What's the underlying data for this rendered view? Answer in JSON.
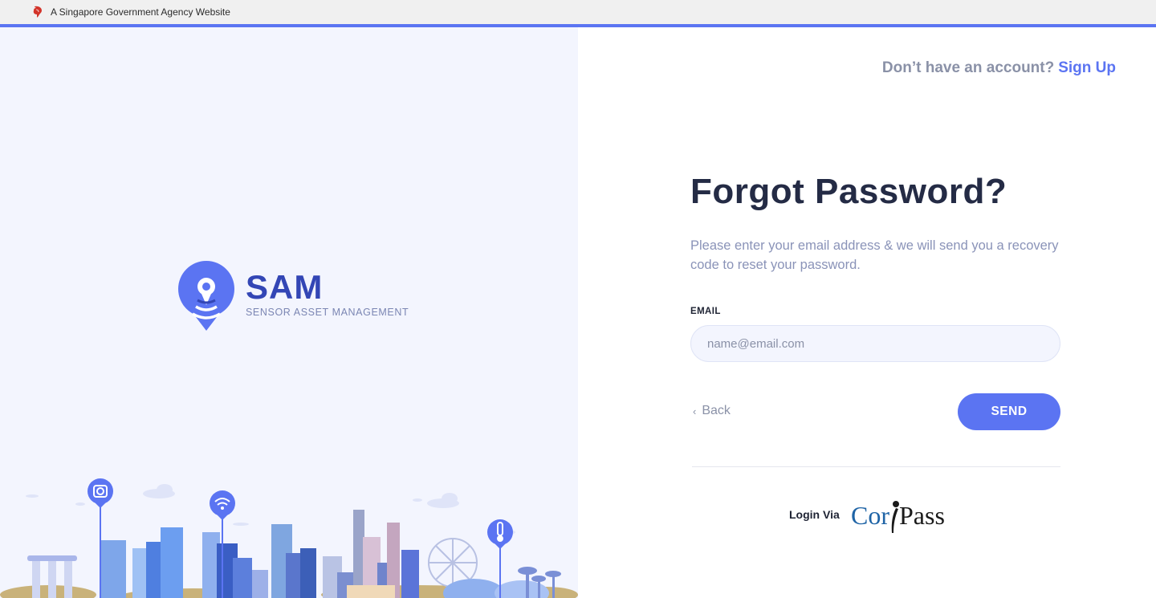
{
  "gov_bar": {
    "text": "A Singapore Government Agency Website"
  },
  "brand": {
    "title": "SAM",
    "subtitle": "SENSOR ASSET MANAGEMENT"
  },
  "header": {
    "signup_question": "Don’t have an account?",
    "signup_link": "Sign Up"
  },
  "form": {
    "title": "Forgot Password?",
    "description": "Please enter your email address & we will send you a recovery code to reset your password.",
    "email_label": "EMAIL",
    "email_placeholder": "name@email.com",
    "email_value": "",
    "back_label": "Back",
    "send_label": "SEND"
  },
  "footer": {
    "login_via": "Login Via",
    "corppass_part1": "Cor",
    "corppass_part2": "Pass"
  },
  "colors": {
    "accent": "#5b74f2",
    "brand_dark": "#3346b5",
    "left_bg": "#f3f5fe"
  },
  "icons": [
    "lion-icon",
    "sam-logo-icon",
    "chevron-left-icon",
    "camera-pin-icon",
    "wifi-pin-icon",
    "thermometer-pin-icon"
  ]
}
